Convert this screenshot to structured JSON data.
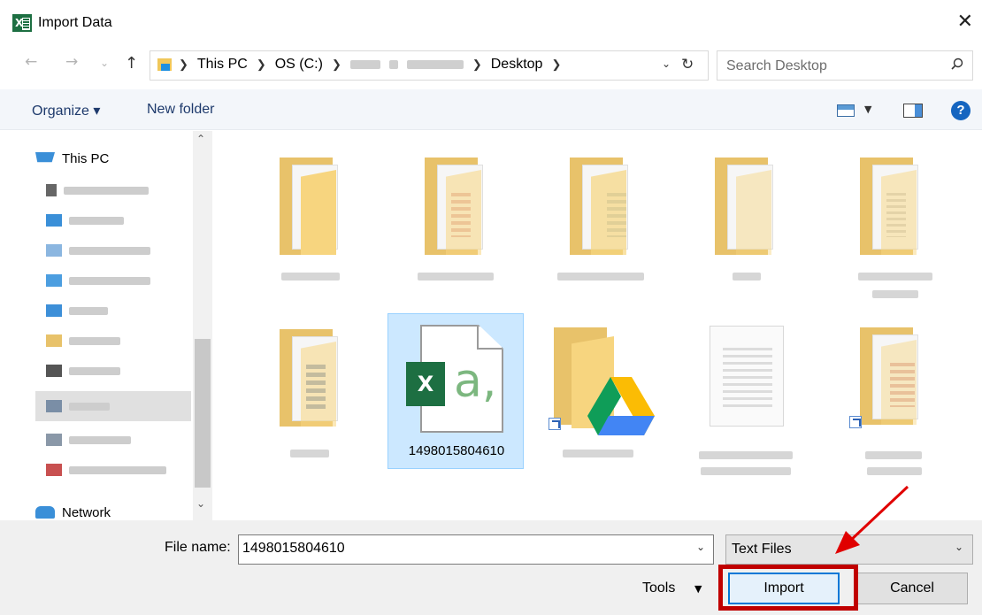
{
  "window": {
    "title": "Import Data",
    "app_icon": "excel-icon",
    "close_icon": "close-icon"
  },
  "nav": {
    "back_icon": "back-arrow-icon",
    "forward_icon": "forward-arrow-icon",
    "recent_icon": "chevron-down-icon",
    "up_icon": "up-arrow-icon",
    "breadcrumbs": [
      "This PC",
      "OS (C:)",
      "Desktop"
    ],
    "refresh_icon": "refresh-icon"
  },
  "search": {
    "placeholder": "Search Desktop",
    "icon": "search-icon"
  },
  "toolbar": {
    "organize_label": "Organize ▾",
    "new_folder_label": "New folder",
    "help_label": "?"
  },
  "navpane": {
    "this_pc_label": "This PC",
    "network_label": "Network"
  },
  "files": [
    {
      "name": "1498015804610",
      "type": "excel-csv",
      "selected": true
    }
  ],
  "footer": {
    "file_name_label": "File name:",
    "file_name_value": "1498015804610",
    "file_type_value": "Text Files",
    "tools_label": "Tools",
    "import_label": "Import",
    "cancel_label": "Cancel"
  },
  "annotation": {
    "color": "#c00000"
  }
}
